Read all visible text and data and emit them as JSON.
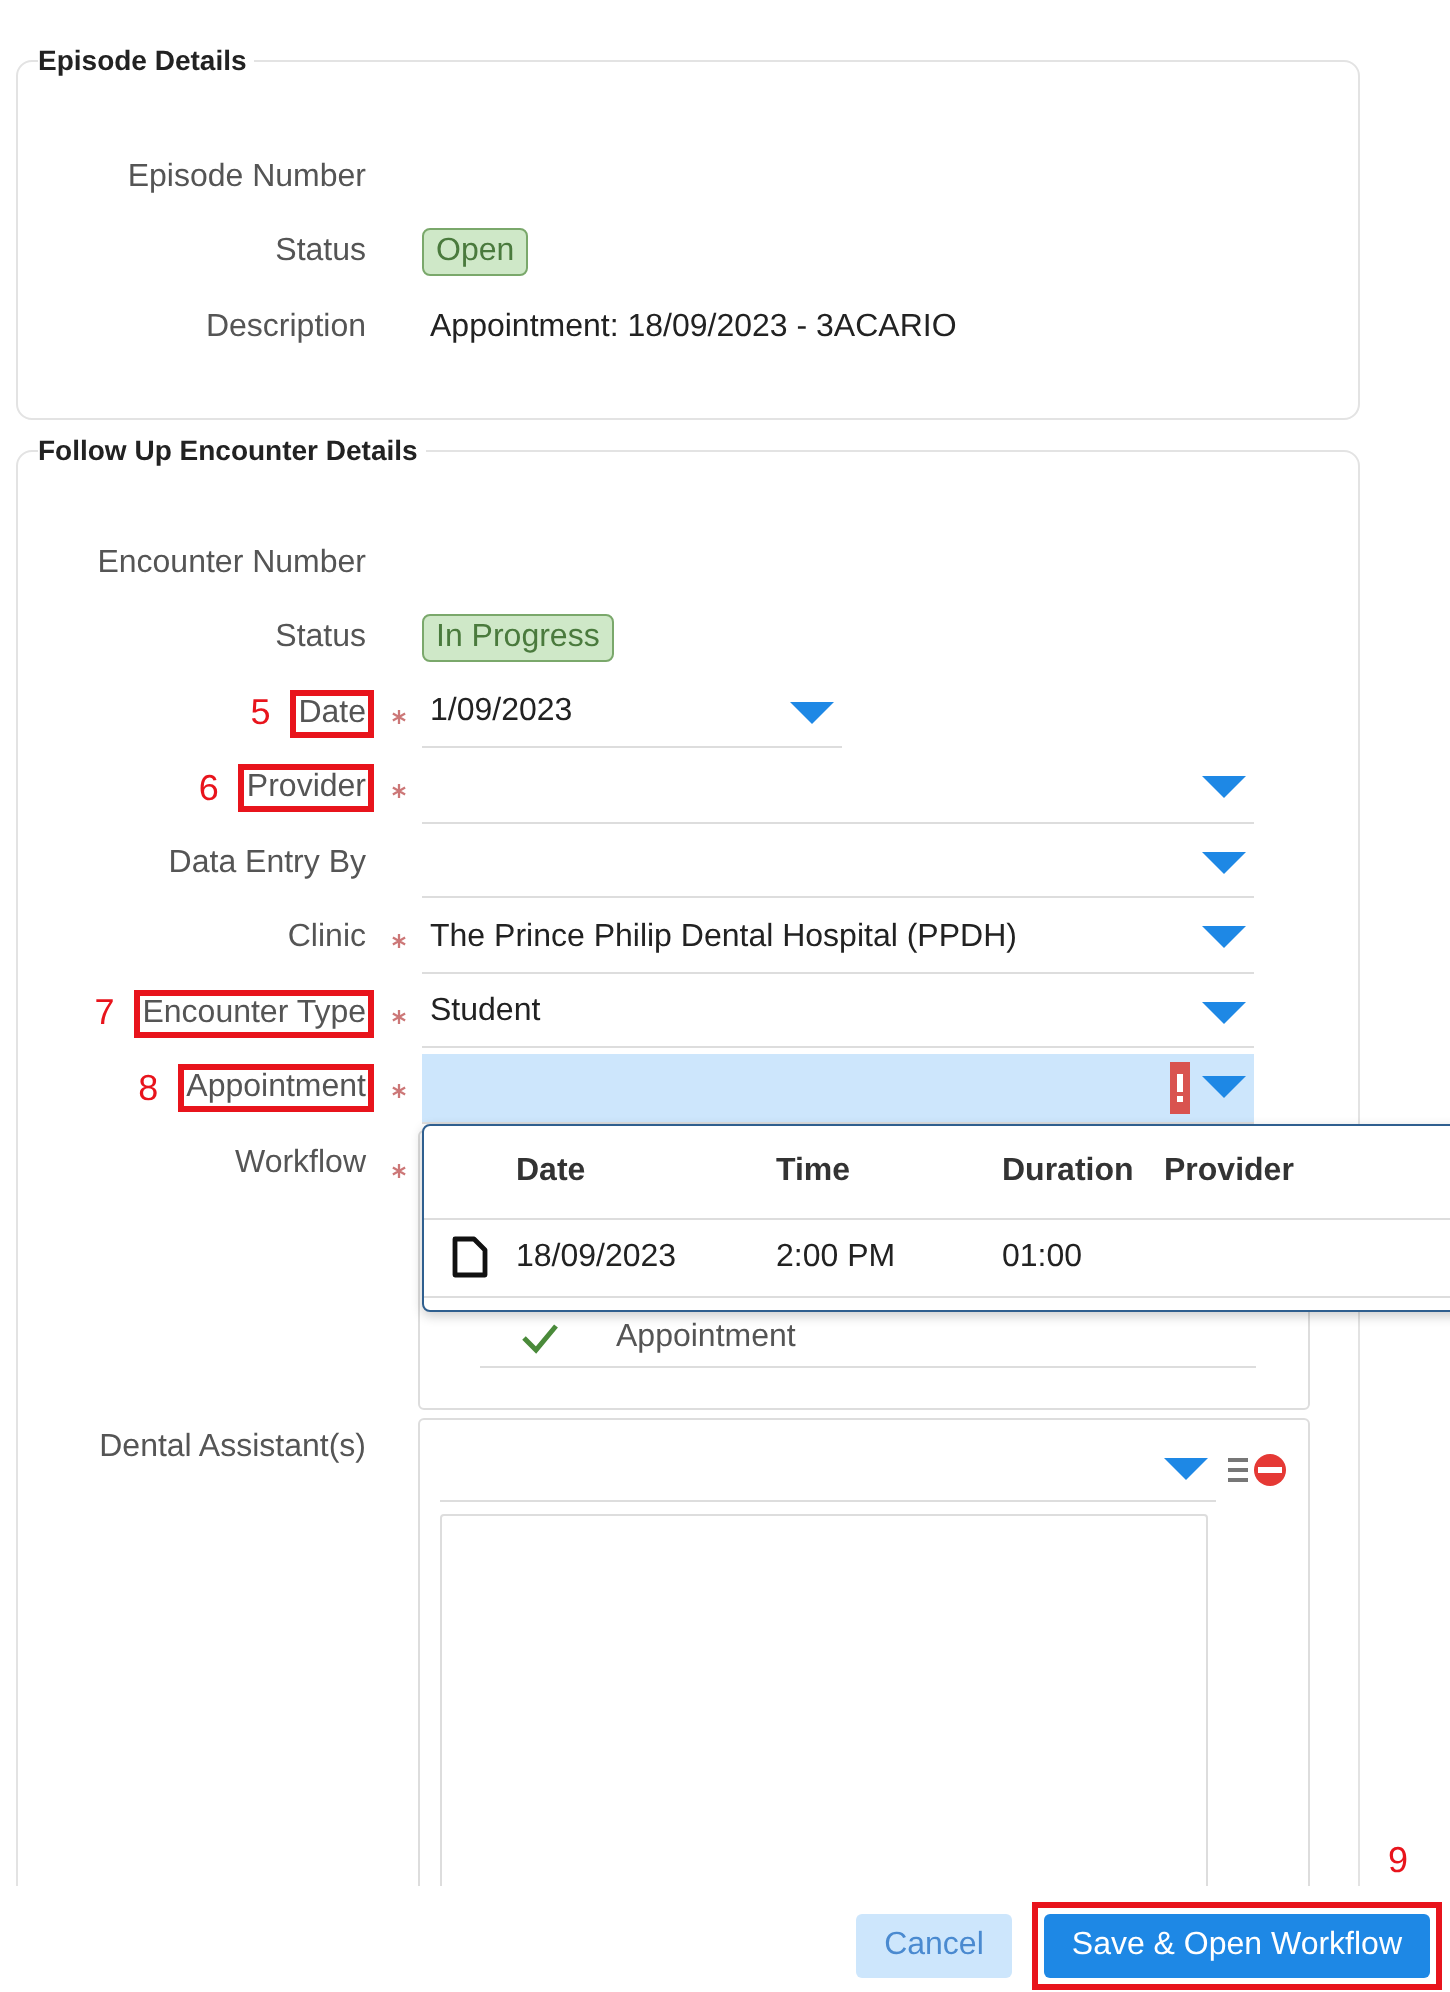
{
  "episode": {
    "legend": "Episode Details",
    "fields": [
      {
        "label": "Episode Number",
        "kind": "text"
      },
      {
        "label": "Status",
        "kind": "badge",
        "value": "Open"
      },
      {
        "label": "Description",
        "kind": "text",
        "value": "Appointment: 18/09/2023 - 3ACARIO"
      }
    ]
  },
  "encounter": {
    "legend": "Follow Up Encounter Details",
    "fields": [
      {
        "label": "Encounter Number",
        "kind": "text"
      },
      {
        "label": "Status",
        "kind": "badge",
        "value": "In Progress"
      },
      {
        "label": "Date",
        "kind": "date",
        "required": true,
        "value": "1/09/2023",
        "annotation": "5"
      },
      {
        "label": "Provider",
        "kind": "select",
        "required": true,
        "annotation": "6"
      },
      {
        "label": "Data Entry By",
        "kind": "select",
        "required": false
      },
      {
        "label": "Clinic",
        "kind": "select",
        "required": true,
        "value": "The Prince Philip Dental Hospital (PPDH)"
      },
      {
        "label": "Encounter Type",
        "kind": "select",
        "required": true,
        "value": "Student",
        "annotation": "7"
      },
      {
        "label": "Appointment",
        "kind": "select",
        "required": true,
        "error": true,
        "annotation": "8",
        "dropdown": {
          "columns": [
            "Date",
            "Time",
            "Duration",
            "Provider"
          ],
          "rows": [
            {
              "cells": [
                "18/09/2023",
                "2:00 PM",
                "01:00"
              ]
            }
          ]
        }
      },
      {
        "label": "Workflow",
        "kind": "checklist",
        "required": true,
        "items": [
          {
            "label": "Appointment",
            "checked": true
          }
        ]
      },
      {
        "label": "Dental Assistant(s)",
        "kind": "multi",
        "required": false
      }
    ]
  },
  "buttons": [
    {
      "label": "Cancel",
      "kind": "secondary"
    },
    {
      "label": "Save & Open Workflow",
      "kind": "primary",
      "annotation": "9"
    }
  ]
}
